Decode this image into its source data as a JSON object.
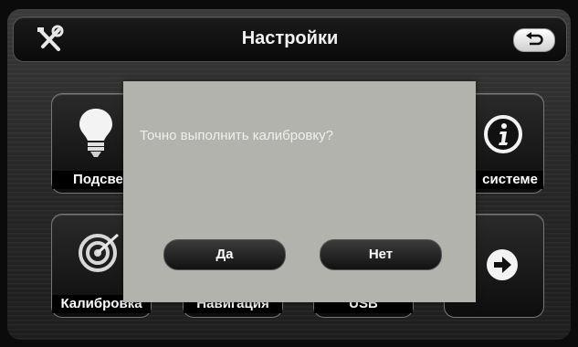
{
  "header": {
    "title": "Настройки",
    "left_icon": "tools-icon",
    "back_icon": "back-arrow-icon"
  },
  "tiles": [
    {
      "label": "Подсвет",
      "icon": "lightbulb-icon"
    },
    {
      "label": "системе",
      "icon": "info-icon"
    },
    {
      "label": "Калибровка",
      "icon": "target-icon"
    },
    {
      "label": "Навигация",
      "icon": ""
    },
    {
      "label": "USB",
      "icon": ""
    },
    {
      "label": "",
      "icon": "arrow-right-icon"
    }
  ],
  "dialog": {
    "message": "Точно выполнить калибровку?",
    "yes_label": "Да",
    "no_label": "Нет"
  },
  "colors": {
    "dialog_bg": "#b3b3ad",
    "button_bg": "#1c1c1c",
    "text": "#ffffff"
  }
}
